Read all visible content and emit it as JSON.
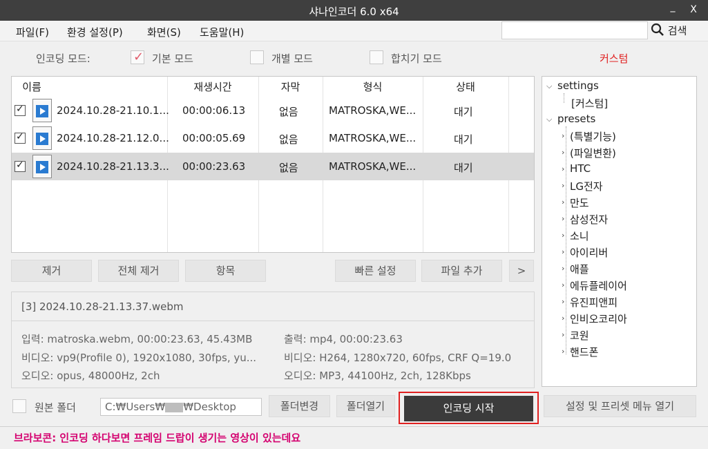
{
  "window": {
    "title": "샤나인코더  6.0 x64",
    "minimize": "_",
    "close": "X"
  },
  "menu": {
    "file": "파일(F)",
    "settings": "환경 설정(P)",
    "view": "화면(S)",
    "help": "도움말(H)"
  },
  "search": {
    "value": "",
    "button": "검색"
  },
  "modes": {
    "label": "인코딩 모드:",
    "basic": "기본 모드",
    "basic_checked": true,
    "individual": "개별 모드",
    "merge": "합치기 모드",
    "custom": "커스텀"
  },
  "colors": {
    "accent_red": "#e02020",
    "status_pink": "#d4006f",
    "check_pink": "#e05a6a",
    "start_bg": "#3b3b3b"
  },
  "filelist": {
    "columns": [
      "이름",
      "재생시간",
      "자막",
      "형식",
      "상태"
    ],
    "rows": [
      {
        "name": "2024.10.28-21.10.1...",
        "duration": "00:00:06.13",
        "subtitle": "없음",
        "format": "MATROSKA,WE...",
        "status": "대기",
        "checked": true,
        "selected": false
      },
      {
        "name": "2024.10.28-21.12.0...",
        "duration": "00:00:05.69",
        "subtitle": "없음",
        "format": "MATROSKA,WE...",
        "status": "대기",
        "checked": true,
        "selected": false
      },
      {
        "name": "2024.10.28-21.13.3...",
        "duration": "00:00:23.63",
        "subtitle": "없음",
        "format": "MATROSKA,WE...",
        "status": "대기",
        "checked": true,
        "selected": true
      }
    ]
  },
  "actions": {
    "remove": "제거",
    "remove_all": "전체 제거",
    "items": "항목",
    "quick_settings": "빠른 설정",
    "add_file": "파일 추가",
    "more": ">"
  },
  "info": {
    "header": "[3] 2024.10.28-21.13.37.webm",
    "input": "입력: matroska.webm, 00:00:23.63, 45.43MB",
    "input_video": "비디오: vp9(Profile 0), 1920x1080, 30fps,  yu...",
    "input_audio": "오디오: opus, 48000Hz, 2ch",
    "output": "출력: mp4, 00:00:23.63",
    "output_video": "비디오: H264, 1280x720, 60fps, CRF Q=19.0",
    "output_audio": "오디오: MP3, 44100Hz, 2ch, 128Kbps"
  },
  "tree": {
    "settings": "settings",
    "custom_child": "[커스텀]",
    "presets": "presets",
    "preset_items": [
      "(특별기능)",
      "(파일변환)",
      "HTC",
      "LG전자",
      "만도",
      "삼성전자",
      "소니",
      "아이리버",
      "애플",
      "에듀플레이어",
      "유진피앤피",
      "인비오코리아",
      "코원",
      "핸드폰"
    ]
  },
  "bottom": {
    "source_folder": "원본 폴더",
    "path_prefix": "C:₩Users₩",
    "path_suffix": "₩Desktop",
    "change_folder": "폴더변경",
    "open_folder": "폴더열기",
    "start": "인코딩 시작",
    "open_menu": "설정 및 프리셋 메뉴 열기"
  },
  "status": "브라보콘: 인코딩 하다보면 프레임 드랍이 생기는 영상이 있는데요"
}
